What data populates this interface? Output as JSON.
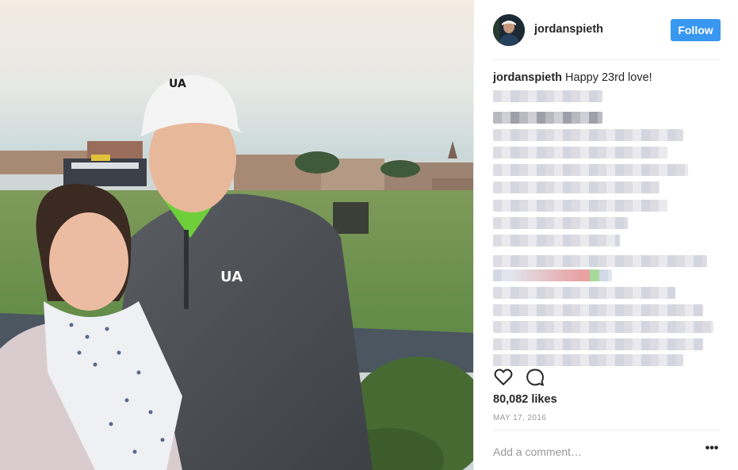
{
  "post": {
    "username": "jordanspieth",
    "follow_label": "Follow",
    "caption_user": "jordanspieth",
    "caption_text": "Happy 23rd love!",
    "likes": "80,082 likes",
    "date": "MAY 17, 2016",
    "comment_placeholder": "Add a comment…",
    "more_label": "•••"
  },
  "icons": {
    "like": "heart-icon",
    "comment": "comment-icon",
    "more": "more-options-icon"
  },
  "colors": {
    "follow_button": "#3897f0",
    "text": "#262626",
    "muted": "#999999",
    "divider": "#efefef"
  }
}
